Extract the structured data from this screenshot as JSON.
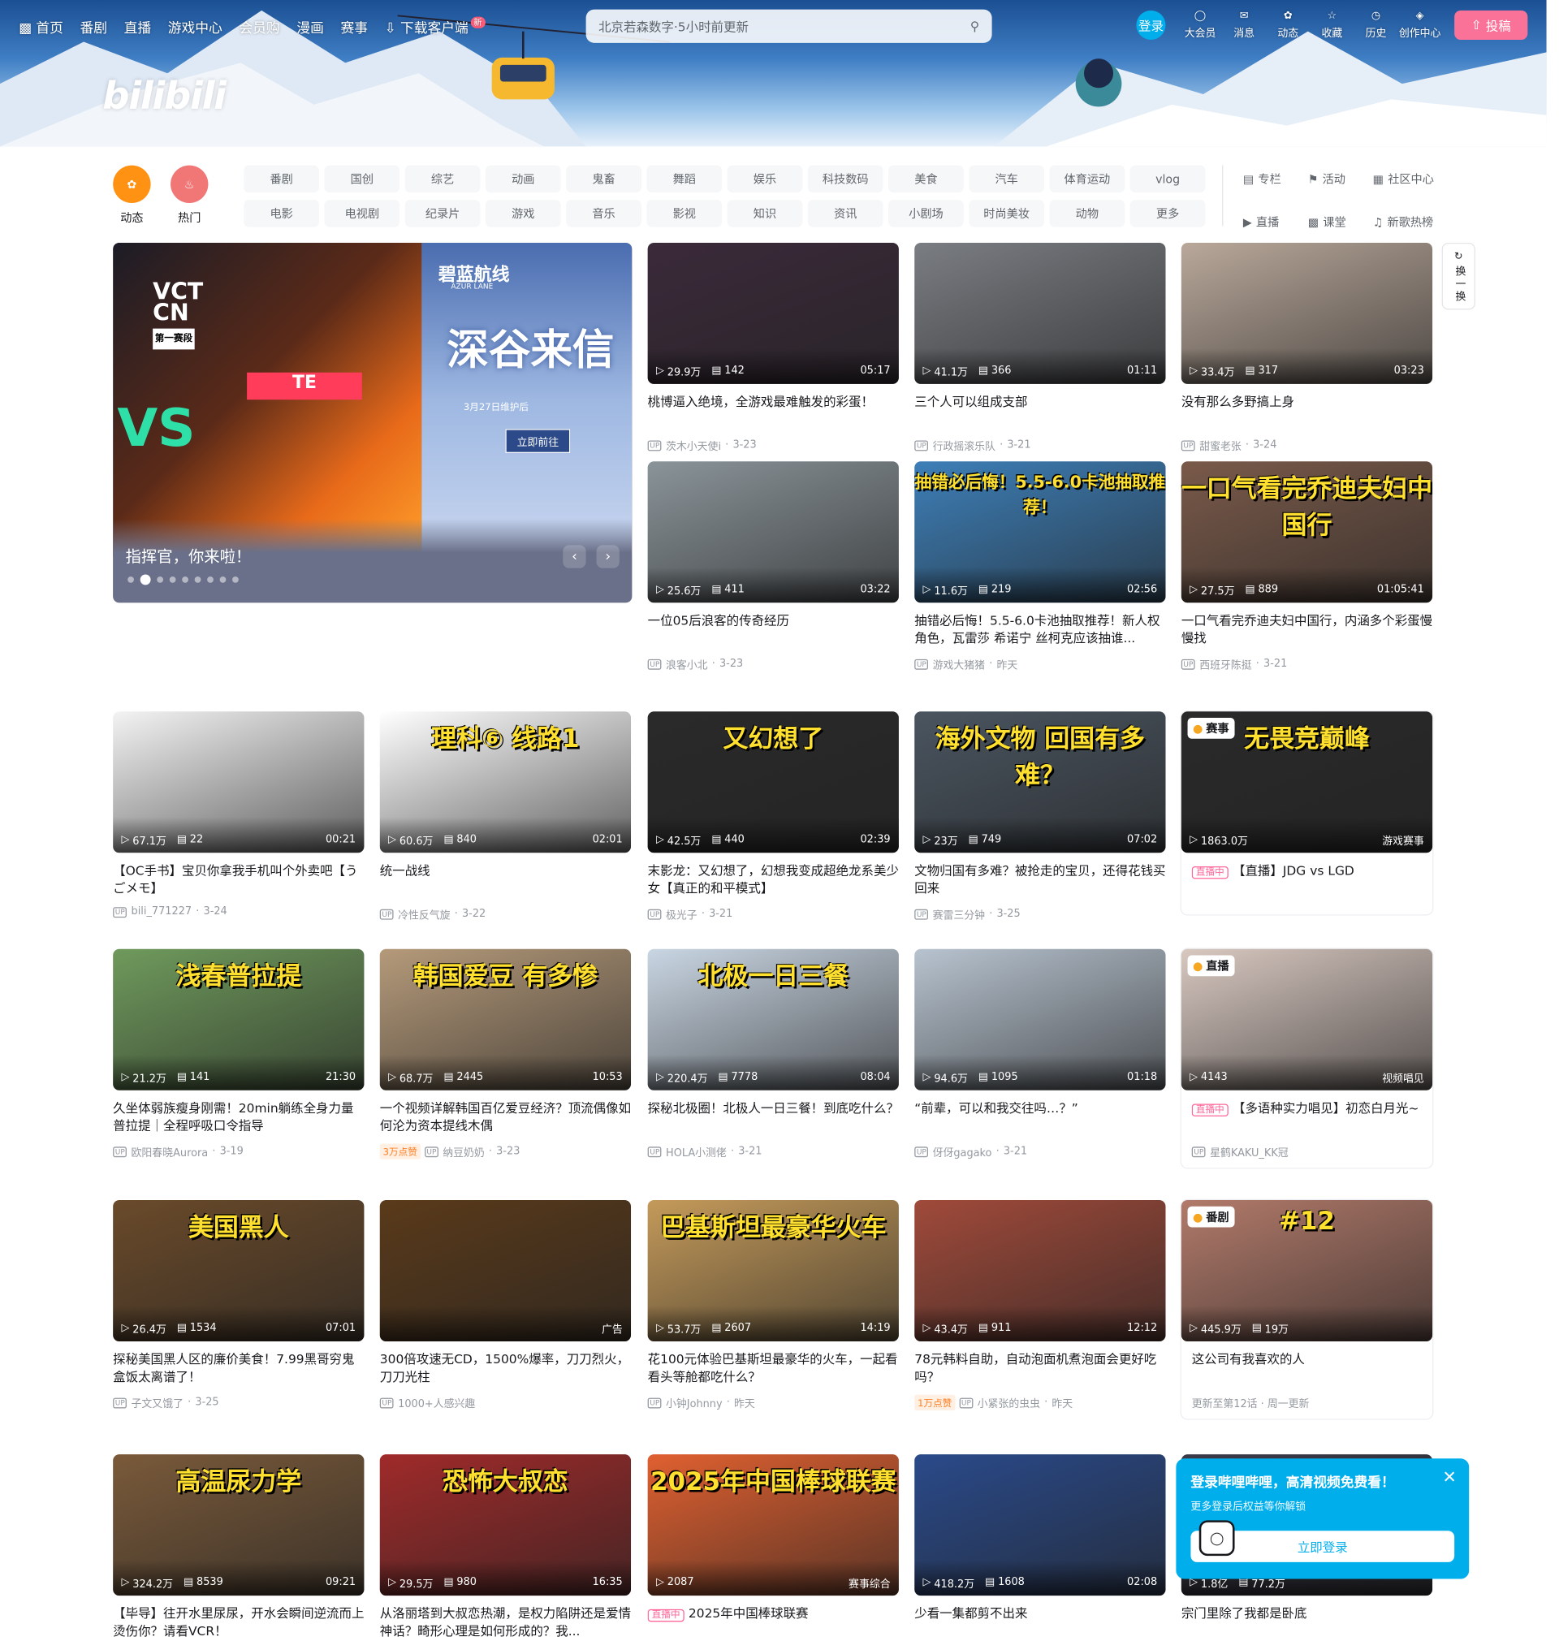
{
  "topnav": {
    "left": [
      "首页",
      "番剧",
      "直播",
      "游戏中心",
      "会员购",
      "漫画",
      "赛事"
    ],
    "download": "下载客户端",
    "new_badge": "新",
    "search_placeholder": "北京若森数字·5小时前更新",
    "login": "登录",
    "right": [
      "大会员",
      "消息",
      "动态",
      "收藏",
      "历史",
      "创作中心"
    ],
    "upload": "投稿"
  },
  "logo_text": "bilibili",
  "channels": {
    "big": [
      "动态",
      "热门"
    ],
    "row1": [
      "番剧",
      "国创",
      "综艺",
      "动画",
      "鬼畜",
      "舞蹈",
      "娱乐",
      "科技数码",
      "美食",
      "汽车",
      "体育运动",
      "vlog"
    ],
    "row2": [
      "电影",
      "电视剧",
      "纪录片",
      "游戏",
      "音乐",
      "影视",
      "知识",
      "资讯",
      "小剧场",
      "时尚美妆",
      "动物",
      "更多"
    ],
    "extras": [
      "专栏",
      "活动",
      "社区中心",
      "直播",
      "课堂",
      "新歌热榜"
    ]
  },
  "carousel": {
    "title": "指挥官，你来啦！",
    "left_texts": [
      "VCT",
      "CN",
      "第一赛段",
      "VS",
      "TE"
    ],
    "right_texts": [
      "碧蓝航线",
      "AZUR LANE",
      "深谷来信",
      "3月27日维护后",
      "立即前往"
    ]
  },
  "refresh": "换一换",
  "cards": [
    {
      "views": "29.9万",
      "danmaku": "142",
      "duration": "05:17",
      "title": "桃博逼入绝境，全游戏最难触发的彩蛋！",
      "author": "茨木小天使i",
      "date": "3-23",
      "color": "#3b2a3a"
    },
    {
      "views": "41.1万",
      "danmaku": "366",
      "duration": "01:11",
      "title": "三个人可以组成支部",
      "author": "行政摇滚乐队",
      "date": "3-21",
      "color": "#7a7d82"
    },
    {
      "views": "33.4万",
      "danmaku": "317",
      "duration": "03:23",
      "title": "没有那么多野搞上身",
      "author": "甜蜜老张",
      "date": "3-24",
      "color": "#b9a89a"
    },
    {
      "views": "25.6万",
      "danmaku": "411",
      "duration": "03:22",
      "title": "一位05后浪客的传奇经历",
      "author": "浪客小北",
      "date": "3-23",
      "color": "#8a9499"
    },
    {
      "views": "11.6万",
      "danmaku": "219",
      "duration": "02:56",
      "title": "抽错必后悔！5.5-6.0卡池抽取推荐！新人权角色，瓦雷莎 希诺宁 丝柯克应该抽谁...",
      "author": "游戏大猪猪",
      "date": "昨天",
      "color": "#3d7fb8",
      "thumbtxt": "抽错必后悔！5.5-6.0卡池抽取推荐！"
    },
    {
      "views": "27.5万",
      "danmaku": "889",
      "duration": "01:05:41",
      "title": "一口气看完乔迪夫妇中国行，内涵多个彩蛋慢慢找",
      "author": "西班牙陈挺",
      "date": "3-21",
      "color": "#7a5a4a",
      "thumbtxt": "一口气看完乔迪夫妇中国行"
    },
    {
      "views": "67.1万",
      "danmaku": "22",
      "duration": "00:21",
      "title": "【OC手书】宝贝你拿我手机叫个外卖吧【うごメモ】",
      "author": "bili_771227",
      "date": "3-24",
      "color": "#f3f3f3"
    },
    {
      "views": "60.6万",
      "danmaku": "840",
      "duration": "02:01",
      "title": "统一战线",
      "author": "冷性反气旋",
      "date": "3-22",
      "color": "#ffffff",
      "thumbtxt": "理科⑥ 线路1"
    },
    {
      "views": "42.5万",
      "danmaku": "440",
      "duration": "02:39",
      "title": "末影龙：又幻想了，幻想我变成超绝龙系美少女【真正的和平模式】",
      "author": "极光子",
      "date": "3-21",
      "color": "#2a2a2a",
      "thumbtxt": "又幻想了"
    },
    {
      "views": "23万",
      "danmaku": "749",
      "duration": "07:02",
      "title": "文物归国有多难？被抢走的宝贝，还得花钱买回来",
      "author": "赛雷三分钟",
      "date": "3-25",
      "color": "#4a5560",
      "thumbtxt": "海外文物 回国有多难？"
    },
    {
      "views": "1863.0万",
      "danmaku": "",
      "duration": "游戏赛事",
      "title": "【直播】JDG vs LGD",
      "author": "",
      "date": "",
      "color": "#2a2a2a",
      "flag": "赛事",
      "live": "直播中",
      "thumbtxt": "无畏竞巅峰"
    },
    {
      "views": "21.2万",
      "danmaku": "141",
      "duration": "21:30",
      "title": "久坐体弱族瘦身刚需！20min躺练全身力量普拉提｜全程呼吸口令指导",
      "author": "欧阳春晓Aurora",
      "date": "3-19",
      "color": "#6f9a5c",
      "thumbtxt": "浅春普拉提"
    },
    {
      "views": "68.7万",
      "danmaku": "2445",
      "duration": "10:53",
      "title": "一个视频详解韩国百亿爱豆经济？顶流偶像如何沦为资本提线木偶",
      "author": "纳豆奶奶",
      "date": "3-23",
      "hot": "3万点赞",
      "color": "#b59a7a",
      "thumbtxt": "韩国爱豆 有多惨"
    },
    {
      "views": "220.4万",
      "danmaku": "7778",
      "duration": "08:04",
      "title": "探秘北极圈！北极人一日三餐！到底吃什么？",
      "author": "HOLA小测佬",
      "date": "3-21",
      "color": "#c9d6e3",
      "thumbtxt": "北极一日三餐"
    },
    {
      "views": "94.6万",
      "danmaku": "1095",
      "duration": "01:18",
      "title": "“前辈，可以和我交往吗…？”",
      "author": "伢伢gagako",
      "date": "3-21",
      "color": "#b7c3cf"
    },
    {
      "views": "4143",
      "danmaku": "",
      "duration": "视频唱见",
      "title": "【多语种实力唱见】初恋白月光~",
      "author": "星鹤KAKU_KK冠",
      "date": "",
      "color": "#d8c8c0",
      "flag": "直播",
      "live": "直播中"
    },
    {
      "views": "26.4万",
      "danmaku": "1534",
      "duration": "07:01",
      "title": "探秘美国黑人区的廉价美食！7.99黑哥穷鬼盒饭太离谱了！",
      "author": "子文又饿了",
      "date": "3-25",
      "color": "#6a4a2a",
      "thumbtxt": "美国黑人"
    },
    {
      "views": "",
      "danmaku": "",
      "duration": "广告",
      "title": "300倍攻速无CD，1500%爆率，刀刀烈火，刀刀光柱",
      "author": "1000+人感兴趣",
      "date": "",
      "color": "#5a3a1a"
    },
    {
      "views": "53.7万",
      "danmaku": "2607",
      "duration": "14:19",
      "title": "花100元体验巴基斯坦最豪华的火车，一起看看头等舱都吃什么？",
      "author": "小钟Johnny",
      "date": "昨天",
      "color": "#c49a5a",
      "thumbtxt": "巴基斯坦最豪华火车"
    },
    {
      "views": "43.4万",
      "danmaku": "911",
      "duration": "12:12",
      "title": "78元韩料自助，自动泡面机煮泡面会更好吃吗？",
      "author": "小紧张的虫虫",
      "date": "昨天",
      "hot": "1万点赞",
      "color": "#a04a3a"
    },
    {
      "views": "445.9万",
      "danmaku": "19万",
      "duration": "",
      "title": "这公司有我喜欢的人",
      "author": "更新至第12话 · 周一更新",
      "date": "",
      "color": "#b27a6a",
      "flag": "番剧",
      "thumbtxt": "#12"
    },
    {
      "views": "324.2万",
      "danmaku": "8539",
      "duration": "09:21",
      "title": "【毕导】往开水里尿尿，开水会瞬间逆流而上烫伤你？请看VCR！",
      "author": "",
      "date": "",
      "color": "#7a5a3a",
      "thumbtxt": "高温尿力学"
    },
    {
      "views": "29.5万",
      "danmaku": "980",
      "duration": "16:35",
      "title": "从洛丽塔到大叔恋热潮，是权力陷阱还是爱情神话？畸形心理是如何形成的？我...",
      "author": "",
      "date": "",
      "color": "#a02a2a",
      "thumbtxt": "恐怖大叔恋"
    },
    {
      "views": "2087",
      "danmaku": "",
      "duration": "赛事综合",
      "title": "2025年中国棒球联赛",
      "author": "",
      "date": "",
      "color": "#e06030",
      "live": "直播中",
      "thumbtxt": "2025年中国棒球联赛"
    },
    {
      "views": "418.2万",
      "danmaku": "1608",
      "duration": "02:08",
      "title": "少看一集都剪不出来",
      "author": "",
      "date": "",
      "color": "#2a4a8a"
    },
    {
      "views": "1.8亿",
      "danmaku": "77.2万",
      "duration": "",
      "title": "宗门里除了我都是卧底",
      "author": "",
      "date": "",
      "color": "#3a3a4a"
    }
  ],
  "popup": {
    "title": "登录哔哩哔哩，高清视频免费看！",
    "sub": "更多登录后权益等你解锁",
    "button": "立即登录"
  }
}
